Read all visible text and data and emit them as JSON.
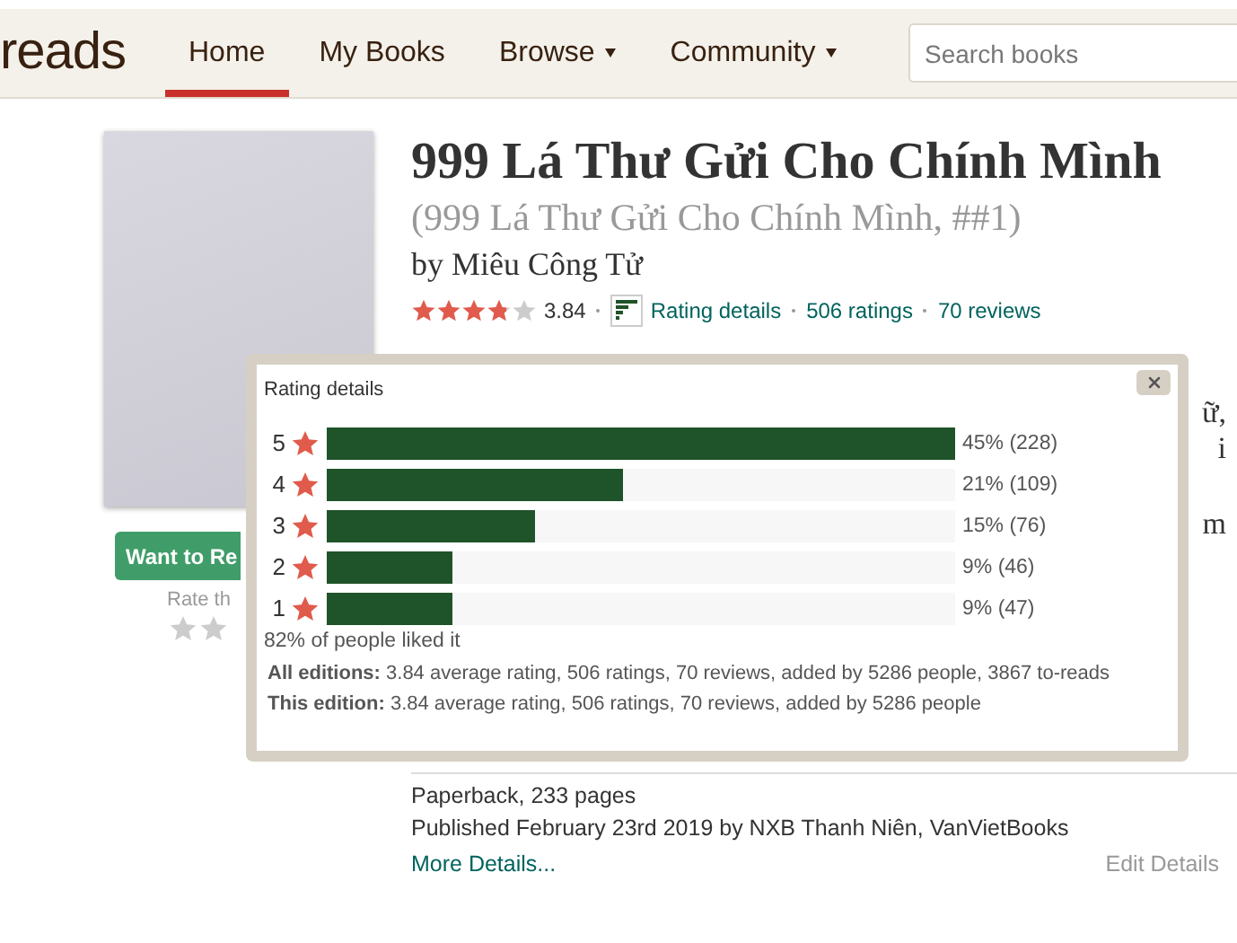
{
  "header": {
    "logo": "reads",
    "nav": [
      {
        "label": "Home",
        "selected": true,
        "dropdown": false
      },
      {
        "label": "My Books",
        "selected": false,
        "dropdown": false
      },
      {
        "label": "Browse",
        "selected": false,
        "dropdown": true
      },
      {
        "label": "Community",
        "selected": false,
        "dropdown": true
      }
    ],
    "search": {
      "placeholder": "Search books"
    }
  },
  "book": {
    "title": "999 Lá Thư Gửi Cho Chính Mình",
    "series": "(999 Lá Thư Gửi Cho Chính Mình, ##1)",
    "author_prefix": "by",
    "author": "Miêu Công Tử",
    "rating": {
      "stars": 3.84,
      "average": "3.84",
      "details_link": "Rating details",
      "ratings": "506 ratings",
      "reviews": "70 reviews"
    },
    "want_button": "Want to Re",
    "rate_label": "Rate th",
    "description_fragments": [
      "ữ,",
      "i",
      "m"
    ],
    "details": {
      "format": "Paperback, 233 pages",
      "published": "Published February 23rd 2019 by NXB Thanh Niên, VanVietBooks",
      "more": "More Details...",
      "edit": "Edit Details"
    }
  },
  "popup": {
    "title": "Rating details",
    "bars": [
      {
        "label": "5",
        "level": 1,
        "reading": "45% (228)"
      },
      {
        "label": "4",
        "level": 0.47,
        "reading": "21% (109)"
      },
      {
        "label": "3",
        "level": 0.33,
        "reading": "15% (76)"
      },
      {
        "label": "2",
        "level": 0.2,
        "reading": "9% (46)"
      },
      {
        "label": "1",
        "level": 0.2,
        "reading": "9% (47)"
      }
    ],
    "liked": "82% of people liked it",
    "editions": [
      {
        "label": "All editions:",
        "text": "3.84 average rating, 506 ratings, 70 reviews, added by 5286 people, 3867 to-reads"
      },
      {
        "label": "This edition:",
        "text": "3.84 average rating, 506 ratings, 70 reviews, added by 5286 people"
      }
    ]
  }
}
